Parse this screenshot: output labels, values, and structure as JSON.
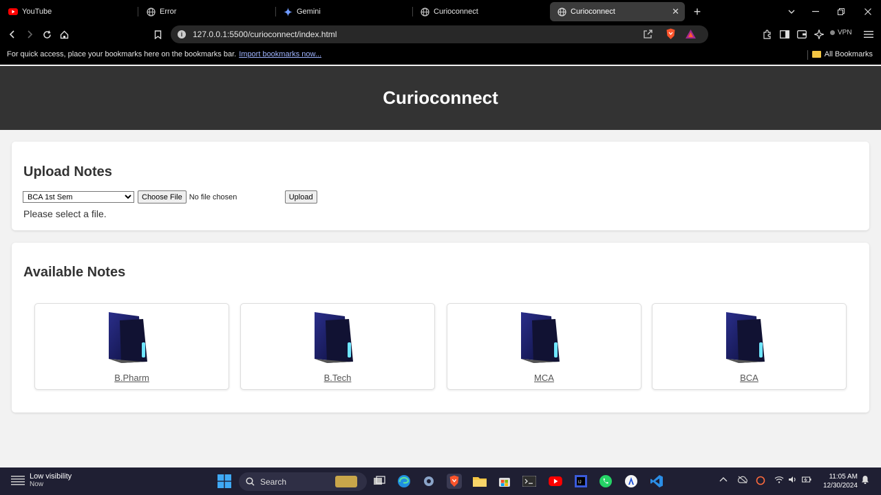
{
  "browser": {
    "tabs": [
      {
        "label": "YouTube",
        "icon": "youtube-icon"
      },
      {
        "label": "Error",
        "icon": "globe-icon"
      },
      {
        "label": "Gemini",
        "icon": "gemini-icon"
      },
      {
        "label": "Curioconnect",
        "icon": "globe-icon"
      },
      {
        "label": "Curioconnect",
        "icon": "globe-icon",
        "active": true
      }
    ],
    "url": "127.0.0.1:5500/curioconnect/index.html",
    "vpn_label": "VPN",
    "bookmarks_message": "For quick access, place your bookmarks here on the bookmarks bar.",
    "bookmarks_import_link": "Import bookmarks now...",
    "all_bookmarks_label": "All Bookmarks"
  },
  "site": {
    "title": "Curioconnect",
    "upload": {
      "heading": "Upload Notes",
      "selected_semester": "BCA 1st Sem",
      "choose_file_label": "Choose File",
      "no_file_text": "No file chosen",
      "upload_button": "Upload",
      "status": "Please select a file."
    },
    "notes": {
      "heading": "Available Notes",
      "folders": [
        "B.Pharm",
        "B.Tech",
        "MCA",
        "BCA"
      ]
    }
  },
  "taskbar": {
    "weather_title": "Low visibility",
    "weather_sub": "Now",
    "search_placeholder": "Search",
    "time": "11:05 AM",
    "date": "12/30/2024"
  },
  "colors": {
    "header_bg": "#333333",
    "page_bg": "#f2f2f2",
    "folder_primary": "#1c1f6b",
    "taskbar_bg": "#1f1f33"
  }
}
